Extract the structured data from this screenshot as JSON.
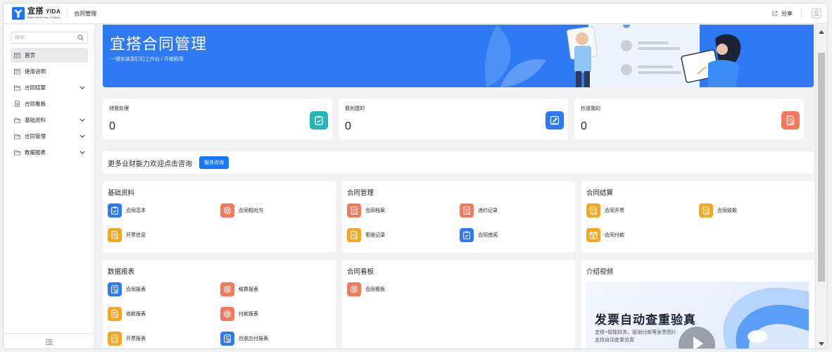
{
  "topbar": {
    "logo_cn": "宜搭",
    "logo_en": "YIDA",
    "logo_tagline": "Make Work Easy & Happy",
    "app_title": "合同管理",
    "share_label": "分享"
  },
  "sidebar": {
    "search_placeholder": "搜索",
    "items": [
      {
        "label": "首页",
        "icon": "home-icon",
        "active": true,
        "expandable": false
      },
      {
        "label": "使用说明",
        "icon": "page-icon",
        "active": false,
        "expandable": false
      },
      {
        "label": "合同结算",
        "icon": "folder-icon",
        "active": false,
        "expandable": true
      },
      {
        "label": "合同看板",
        "icon": "dashboard-icon",
        "active": false,
        "expandable": false
      },
      {
        "label": "基础资料",
        "icon": "folder-icon",
        "active": false,
        "expandable": true
      },
      {
        "label": "合同管理",
        "icon": "folder-icon",
        "active": false,
        "expandable": true
      },
      {
        "label": "数据报表",
        "icon": "folder-icon",
        "active": false,
        "expandable": true
      }
    ]
  },
  "banner": {
    "title": "宜搭合同管理",
    "subtitle": "一键安装到钉钉工作台 / 开箱即用"
  },
  "stats": [
    {
      "title": "待我处理",
      "value": "0",
      "color": "#26b5b5",
      "icon": "clipboard-check-icon"
    },
    {
      "title": "我创建的",
      "value": "0",
      "color": "#2f7af4",
      "icon": "edit-icon"
    },
    {
      "title": "抄送我的",
      "value": "0",
      "color": "#f2795b",
      "icon": "doc-cc-icon"
    }
  ],
  "consult": {
    "text": "更多业财能力欢迎点击咨询",
    "button": "服务咨询"
  },
  "cards": {
    "basic": {
      "title": "基础资料",
      "links": [
        {
          "label": "合同范本",
          "color": "#2f7af4",
          "icon": "clipboard-icon"
        },
        {
          "label": "合同相对方",
          "color": "#f2795b",
          "icon": "flower-icon"
        },
        {
          "label": "开票信息",
          "color": "#f5a623",
          "icon": "document-icon"
        }
      ]
    },
    "manage": {
      "title": "合同管理",
      "links": [
        {
          "label": "合同档案",
          "color": "#f2795b",
          "icon": "document-icon"
        },
        {
          "label": "违约记录",
          "color": "#f2795b",
          "icon": "document-icon"
        },
        {
          "label": "索赔记录",
          "color": "#f5a623",
          "icon": "document-icon"
        },
        {
          "label": "合同借阅",
          "color": "#2f7af4",
          "icon": "clipboard-icon"
        }
      ]
    },
    "settle": {
      "title": "合同结算",
      "links": [
        {
          "label": "合同开票",
          "color": "#f5a623",
          "icon": "document-icon"
        },
        {
          "label": "合同收款",
          "color": "#f5a623",
          "icon": "document-icon"
        },
        {
          "label": "合同付款",
          "color": "#f5a623",
          "icon": "calendar-icon"
        }
      ]
    },
    "report": {
      "title": "数据报表",
      "links": [
        {
          "label": "合同报表",
          "color": "#2f7af4",
          "icon": "report-icon"
        },
        {
          "label": "结算报表",
          "color": "#f2795b",
          "icon": "flower-icon"
        },
        {
          "label": "收款报表",
          "color": "#f5a623",
          "icon": "document-icon"
        },
        {
          "label": "付款报表",
          "color": "#f2795b",
          "icon": "flower-icon"
        },
        {
          "label": "开票报表",
          "color": "#f5a623",
          "icon": "document-icon"
        },
        {
          "label": "应收应付报表",
          "color": "#2f7af4",
          "icon": "report-icon"
        }
      ]
    },
    "board": {
      "title": "合同看板",
      "links": [
        {
          "label": "合同看板",
          "color": "#f2795b",
          "icon": "flower-icon"
        }
      ]
    },
    "video": {
      "title": "介绍视频",
      "poster_title": "发票自动查重验真",
      "poster_line1": "宜搭+智能财务，报销付款等发票图片",
      "poster_line2": "支持自动查重验真"
    }
  }
}
